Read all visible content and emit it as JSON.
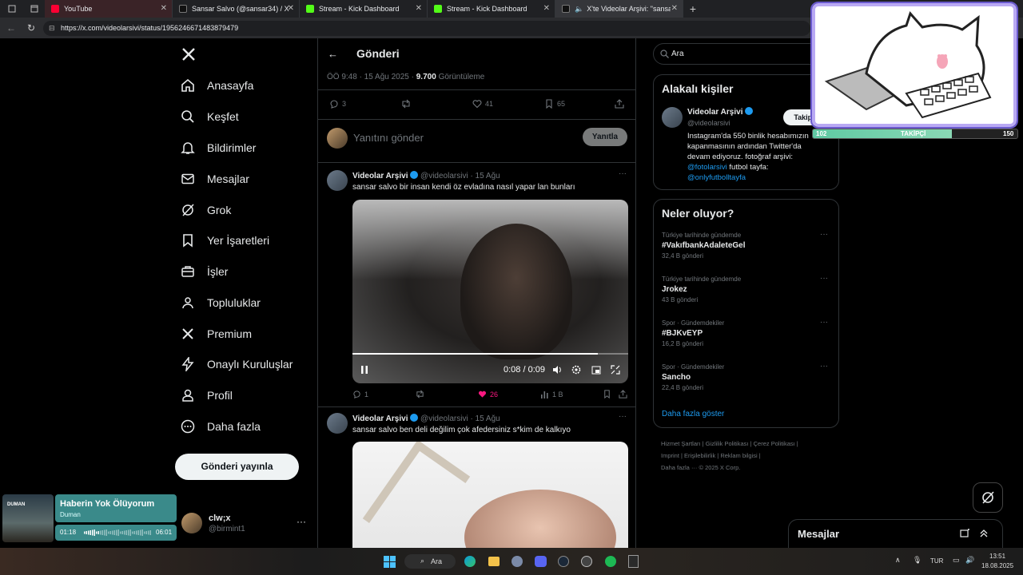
{
  "browser": {
    "tabs": [
      {
        "title": "YouTube",
        "color": "#ff0033"
      },
      {
        "title": "Sansar Salvo (@sansar34) / X",
        "color": "#111111"
      },
      {
        "title": "Stream - Kick Dashboard",
        "color": "#53fc18"
      },
      {
        "title": "Stream - Kick Dashboard",
        "color": "#53fc18"
      },
      {
        "title": "X'te Videolar Arşivi: \"sansar s",
        "color": "#111111"
      }
    ],
    "url": "https://x.com/videolarsivi/status/1956246671483879479"
  },
  "nav": {
    "items": [
      "Anasayfa",
      "Keşfet",
      "Bildirimler",
      "Mesajlar",
      "Grok",
      "Yer İşaretleri",
      "İşler",
      "Topluluklar",
      "Premium",
      "Onaylı Kuruluşlar",
      "Profil",
      "Daha fazla"
    ],
    "post_button": "Gönderi yayınla",
    "account": {
      "name": "clw;x",
      "handle": "@birmint1"
    }
  },
  "music_widget": {
    "title": "Haberin Yok Ölüyorum",
    "artist": "Duman",
    "album_label": "DUMAN",
    "elapsed": "01:18",
    "total": "06:01",
    "progress": 0.216
  },
  "header": {
    "title": "Gönderi"
  },
  "main_post": {
    "time": "ÖÖ 9:48 · 15 Ağu 2025 · ",
    "views": "9.700",
    "views_label": "Görüntüleme",
    "replies": "3",
    "likes": "41",
    "bookmarks": "65"
  },
  "reply_box": {
    "placeholder": "Yanıtını gönder",
    "button": "Yanıtla"
  },
  "posts": [
    {
      "name": "Videolar Arşivi",
      "handle": "@videolarsivi",
      "date": "· 15 Ağu",
      "text": "sansar salvo bir insan kendi öz evladına nasıl yapar lan bunları",
      "video_time": "0:08 / 0:09",
      "video_progress": 0.89,
      "replies": "1",
      "likes": "26",
      "views": "1 B"
    },
    {
      "name": "Videolar Arşivi",
      "handle": "@videolarsivi",
      "date": "· 15 Ağu",
      "text": "sansar salvo ben deli değilim çok afedersiniz s*kim de kalkıyo"
    }
  ],
  "search": {
    "placeholder": "Ara"
  },
  "related": {
    "title": "Alakalı kişiler",
    "name": "Videolar Arşivi",
    "handle": "@videolarsivi",
    "follow": "Takip et",
    "bio": "Instagram'da 550 binlik hesabımızın kapanmasının ardından Twitter'da devam ediyoruz. fotoğraf arşivi:",
    "link1": "@fotolarsivi",
    "bio2": " futbol tayfa:",
    "link2": "@onlyfutbolltayfa"
  },
  "trends": {
    "title": "Neler oluyor?",
    "items": [
      {
        "cat": "Türkiye tarihinde gündemde",
        "name": "#VakıfbankAdaleteGel",
        "count": "32,4 B gönderi"
      },
      {
        "cat": "Türkiye tarihinde gündemde",
        "name": "Jrokez",
        "count": "43 B gönderi"
      },
      {
        "cat": "Spor · Gündemdekiler",
        "name": "#BJKvEYP",
        "count": "16,2 B gönderi"
      },
      {
        "cat": "Spor · Gündemdekiler",
        "name": "Sancho",
        "count": "22,4 B gönderi"
      }
    ],
    "more": "Daha fazla göster"
  },
  "footer_links": [
    "Hizmet Şartları",
    "Gizlilik Politikası",
    "Çerez Politikası",
    "Imprint",
    "Erişilebilirlik",
    "Reklam bilgisi",
    "Daha fazla ···",
    "© 2025 X Corp."
  ],
  "messages_drawer": {
    "title": "Mesajlar"
  },
  "follower_overlay": {
    "current": "102",
    "label": "TAKİPÇİ",
    "goal": "150",
    "progress": 0.68
  },
  "taskbar": {
    "search": "Ara",
    "lang": "TUR",
    "time": "13:51",
    "date": "18.08.2025"
  }
}
